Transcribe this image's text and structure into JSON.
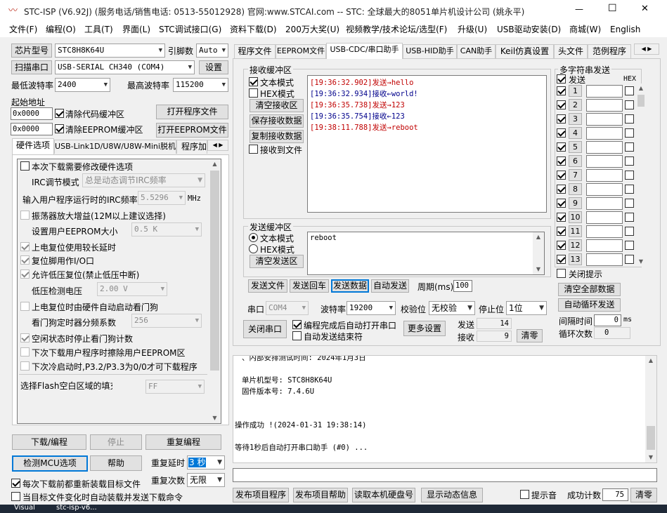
{
  "window": {
    "title": "STC-ISP (V6.92J) (服务电话/销售电话: 0513-55012928) 官网:www.STCAI.com  -- STC: 全球最大的8051单片机设计公司 (姚永平)",
    "minimize": "—",
    "maximize": "☐",
    "close": "✕"
  },
  "menu": [
    "文件(F)",
    "编程(O)",
    "工具(T)",
    "界面(L)",
    "STC调试接口(G)",
    "资料下载(D)",
    "200万大奖(U)",
    "视频教学/技术论坛/选型(F)",
    "升级(U)",
    "USB驱动安装(D)",
    "商城(W)",
    "English"
  ],
  "left": {
    "chip_btn": "芯片型号",
    "chip_value": "STC8H8K64U",
    "pin_label": "引脚数",
    "pin_value": "Auto",
    "scan_btn": "扫描串口",
    "port_value": "USB-SERIAL CH340 (COM4)",
    "settings_btn": "设置",
    "min_baud_label": "最低波特率",
    "min_baud_value": "2400",
    "max_baud_label": "最高波特率",
    "max_baud_value": "115200",
    "start_addr_label": "起始地址",
    "addr1": "0x0000",
    "clear_code_label": "清除代码缓冲区",
    "open_prog_btn": "打开程序文件",
    "addr2": "0x0000",
    "clear_eeprom_label": "清除EEPROM缓冲区",
    "open_eeprom_btn": "打开EEPROM文件",
    "tabs": [
      "硬件选项",
      "USB-Link1D/U8W/U8W-Mini脱机",
      "程序加"
    ],
    "hw": {
      "modify_label": "本次下载需要修改硬件选项",
      "irc_mode_label": "IRC调节模式",
      "irc_mode_value": "总是动态调节IRC频率",
      "irc_freq_label": "输入用户程序运行时的IRC频率",
      "irc_freq_value": "5.5296",
      "irc_unit": "MHz",
      "osc_gain_label": "振荡器放大增益(12M以上建议选择)",
      "eeprom_size_label": "设置用户EEPROM大小",
      "eeprom_size_value": "0.5 K",
      "long_delay_label": "上电复位使用较长延时",
      "reset_io_label": "复位脚用作I/O口",
      "lvr_label": "允许低压复位(禁止低压中断)",
      "lvd_label": "低压检测电压",
      "lvd_value": "2.00 V",
      "wdt_label": "上电复位时由硬件自动启动看门狗",
      "wdt_div_label": "看门狗定时器分频系数",
      "wdt_div_value": "256",
      "idle_wdt_label": "空闲状态时停止看门狗计数",
      "erase_eeprom_label": "下次下载用户程序时擦除用户EEPROM区",
      "cold_boot_label": "下次冷启动时,P3.2/P3.3为0/0才可下载程序",
      "flash_fill_label": "选择Flash空白区域的填充",
      "flash_fill_value": "FF"
    },
    "download_btn": "下载/编程",
    "stop_btn": "停止",
    "reprog_btn": "重复编程",
    "detect_btn": "检测MCU选项",
    "help_btn": "帮助",
    "retry_delay_label": "重复延时",
    "retry_delay_value": "3 秒",
    "retry_count_label": "重复次数",
    "retry_count_value": "无限",
    "reload_label": "每次下载前都重新装载目标文件",
    "auto_reload_label": "当目标文件变化时自动装载并发送下载命令"
  },
  "tabs": [
    "程序文件",
    "EEPROM文件",
    "USB-CDC/串口助手",
    "USB-HID助手",
    "CAN助手",
    "Keil仿真设置",
    "头文件",
    "范例程序"
  ],
  "serial": {
    "recv_group": "接收缓冲区",
    "text_mode": "文本模式",
    "hex_mode": "HEX模式",
    "clear_recv": "清空接收区",
    "save_recv": "保存接收数据",
    "copy_recv": "复制接收数据",
    "recv_to_file": "接收到文件",
    "recv_lines": [
      {
        "t": "[19:36:32.902]发送→hello",
        "c": "#c00000"
      },
      {
        "t": "[19:36:32.934]接收←world!",
        "c": "#00008b"
      },
      {
        "t": "[19:36:35.738]发送→123",
        "c": "#c00000"
      },
      {
        "t": "[19:36:35.754]接收←123",
        "c": "#00008b"
      },
      {
        "t": "[19:38:11.788]发送→reboot",
        "c": "#c00000"
      }
    ],
    "send_group": "发送缓冲区",
    "send_text_mode": "文本模式",
    "send_hex_mode": "HEX模式",
    "clear_send": "清空发送区",
    "send_content": "reboot",
    "send_file_btn": "发送文件",
    "send_return_btn": "发送回车",
    "send_data_btn": "发送数据",
    "auto_send_btn": "自动发送",
    "period_label": "周期(ms)",
    "period_value": "100",
    "port_label": "串口",
    "port_value": "COM4",
    "baud_label": "波特率",
    "baud_value": "19200",
    "parity_label": "校验位",
    "parity_value": "无校验",
    "stop_label": "停止位",
    "stop_value": "1位",
    "close_port_btn": "关闭串口",
    "auto_open_label": "编程完成后自动打开串口",
    "auto_end_label": "自动发送结束符",
    "more_btn": "更多设置",
    "tx_label": "发送",
    "tx_value": "14",
    "rx_label": "接收",
    "rx_value": "9",
    "clear_count_btn": "清零"
  },
  "multi": {
    "title": "多字符串发送",
    "send_header": "发送",
    "hex_header": "HEX",
    "rows": [
      "1",
      "2",
      "3",
      "4",
      "5",
      "6",
      "7",
      "8",
      "9",
      "10",
      "11",
      "12",
      "13"
    ],
    "close_hint_label": "关闭提示",
    "clear_all_btn": "清空全部数据",
    "auto_loop_btn": "自动循环发送",
    "interval_label": "间隔时间",
    "interval_value": "0",
    "interval_unit": "ms",
    "loop_label": "循环次数",
    "loop_value": "0"
  },
  "log": {
    "line_partial": "、内部安排测试时间: 2024年1月3日",
    "model": "单片机型号: STC8H8K64U",
    "firmware": "固件版本号: 7.4.6U",
    "success": "操作成功 !(2024-01-31 19:38:14)",
    "waiting": "等待1秒后自动打开串口助手 (#0) ..."
  },
  "bottom": {
    "publish_prog": "发布项目程序",
    "publish_help": "发布项目帮助",
    "read_disk": "读取本机硬盘号",
    "show_anim": "显示动态信息",
    "beep_label": "提示音",
    "success_count_label": "成功计数",
    "success_count_value": "75",
    "clear_btn": "清零"
  },
  "taskbar": {
    "item1": "Visual",
    "item2": "stc-isp-v6..."
  },
  "colors": {
    "send": "#c00000",
    "recv": "#00008b",
    "focus": "#0078d7"
  }
}
